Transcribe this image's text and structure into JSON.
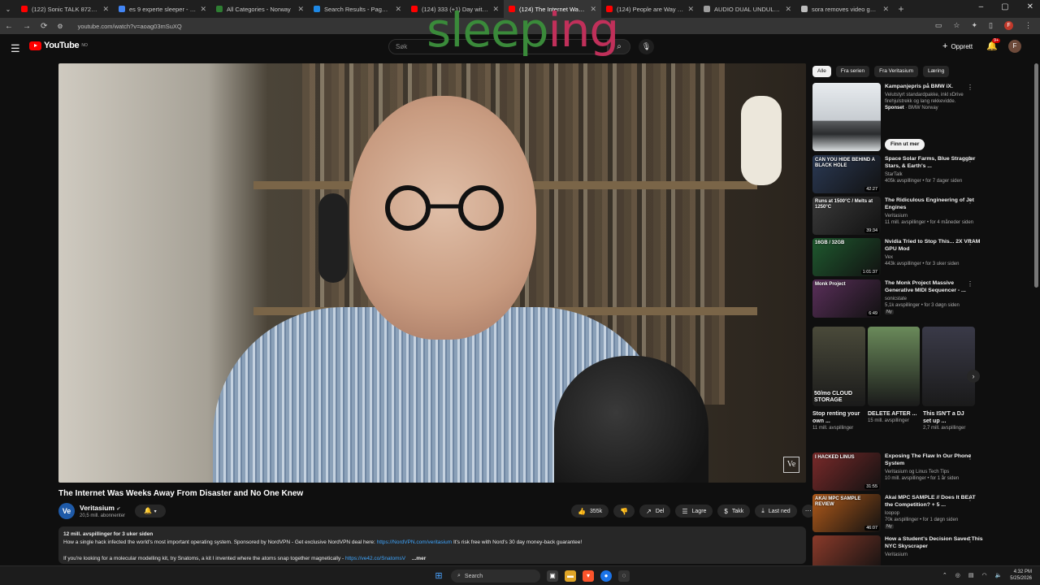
{
  "browser": {
    "tabs": [
      {
        "title": "(122) Sonic TALK 872 - Nadia S",
        "favicon_color": "#ff0000",
        "active": false
      },
      {
        "title": "es 9 experte sleeper - Google S",
        "favicon_color": "#4285f4",
        "active": false
      },
      {
        "title": "All Categories - Norway",
        "favicon_color": "#2e7d32",
        "active": false
      },
      {
        "title": "Search Results - Page 1 - \"dual",
        "favicon_color": "#1e88e5",
        "active": false
      },
      {
        "title": "(124) 333 (+1) Day with the El",
        "favicon_color": "#ff0000",
        "active": false
      },
      {
        "title": "(124) The Internet Was Wee",
        "favicon_color": "#ff0000",
        "active": true
      },
      {
        "title": "(124) People are Way Too Creat",
        "favicon_color": "#ff0000",
        "active": false
      },
      {
        "title": "AUDIO DUAL UNDULA OSCILL",
        "favicon_color": "#9e9e9e",
        "active": false
      },
      {
        "title": "sora removes video generating",
        "favicon_color": "#bdbdbd",
        "active": false
      }
    ],
    "url": "youtube.com/watch?v=aoag03mSuXQ",
    "profile_initial": "F"
  },
  "overlay_text": "sleeping",
  "youtube": {
    "logo_text": "YouTube",
    "region": "NO",
    "search_placeholder": "Søk",
    "create_label": "Opprett",
    "notification_badge": "9+",
    "avatar_initial": "F"
  },
  "video": {
    "title": "The Internet Was Weeks Away From Disaster and No One Knew",
    "watermark": "Ve",
    "channel": {
      "name": "Veritasium",
      "avatar_text": "Ve",
      "subscribers": "20,5 mill. abonnenter"
    },
    "actions": {
      "likes": "355k",
      "share": "Del",
      "save": "Lagre",
      "thanks": "Takk",
      "download": "Last ned"
    },
    "description": {
      "stats": "12 mill. avspillinger  for 3 uker siden",
      "line1_text": "How a single hack infected the world's most important operating system. Sponsored by NordVPN - Get exclusive NordVPN deal here: ",
      "line1_link": "https://NordVPN.com/veritasium",
      "line1_tail": " It's risk free with Nord's 30 day money-back guarantee!",
      "line2_text": "If you're looking for a molecular modelling kit, try Snatoms, a kit I invented where the atoms snap together magnetically - ",
      "line2_link": "https://ve42.co/SnatomsV",
      "more": "...mer"
    }
  },
  "sidebar": {
    "chips": [
      {
        "label": "Alle",
        "active": true
      },
      {
        "label": "Fra serien",
        "active": false
      },
      {
        "label": "Fra Veritasium",
        "active": false
      },
      {
        "label": "Læring",
        "active": false
      }
    ],
    "ad": {
      "title": "Kampanjepris på BMW iX.",
      "body": "Velutstyrt standardpakke, inkl xDrive firehjulstrekk og lang rekkevidde.",
      "sponsor_label": "Sponset",
      "sponsor": "BMW Norway",
      "cta": "Finn ut mer"
    },
    "recommendations": [
      {
        "title": "Space Solar Farms, Blue Straggler Stars, & Earth's ...",
        "channel": "StarTalk",
        "meta": "405k avspillinger • for 7 dager siden",
        "duration": "42:27",
        "thumb_text": "CAN YOU HIDE BEHIND A BLACK HOLE",
        "color": "#2b3a55"
      },
      {
        "title": "The Ridiculous Engineering of Jet Engines",
        "channel": "Veritasium",
        "meta": "11 mill. avspillinger • for 4 måneder siden",
        "duration": "39:34",
        "thumb_text": "Runs at 1500°C / Melts at 1250°C",
        "color": "#3b3b3b"
      },
      {
        "title": "Nvidia Tried to Stop This... 2X VRAM GPU Mod",
        "channel": "Vex",
        "meta": "443k avspillinger • for 3 uker siden",
        "duration": "1:01:37",
        "thumb_text": "16GB / 32GB",
        "color": "#1f5a2f"
      },
      {
        "title": "The Monk Project Massive Generative MIDI Sequencer - ...",
        "channel": "sonicstate",
        "meta": "5,1k avspillinger • for 3 døgn siden",
        "duration": "6:49",
        "thumb_text": "Monk Project",
        "color": "#5a2f5a",
        "badge": "Ny"
      }
    ],
    "shorts": [
      {
        "title": "Stop renting your own ...",
        "views": "11 mill. avspillinger",
        "overlay": "50/mo CLOUD STORAGE",
        "color": "#4a4a3a"
      },
      {
        "title": "DELETE AFTER ...",
        "views": "15 mill. avspillinger",
        "overlay": "",
        "color": "#6a8a5a"
      },
      {
        "title": "This ISN'T a DJ set up ...",
        "views": "2,7 mill. avspillinger",
        "overlay": "",
        "color": "#3a3a48"
      }
    ],
    "recommendations2": [
      {
        "title": "Exposing The Flaw In Our Phone System",
        "channel": "Veritasium og Linus Tech Tips",
        "meta": "10 mill. avspillinger • for 1 år siden",
        "duration": "31:55",
        "thumb_text": "I HACKED LINUS",
        "color": "#7a2a2a"
      },
      {
        "title": "Akai MPC SAMPLE // Does It BEAT the Competition? + 5 ...",
        "channel": "loopop",
        "meta": "70k avspillinger • for 1 døgn siden",
        "duration": "46:07",
        "thumb_text": "AKAI MPC SAMPLE  REVIEW",
        "color": "#b05a1a",
        "badge": "Ny"
      },
      {
        "title": "How a Student's Decision Saved This NYC Skyscraper",
        "channel": "Veritasium",
        "meta": "",
        "duration": "",
        "thumb_text": "",
        "color": "#8a3a2a"
      }
    ]
  },
  "taskbar": {
    "search_label": "Search",
    "time": "4:32 PM",
    "date": "5/25/2026"
  }
}
